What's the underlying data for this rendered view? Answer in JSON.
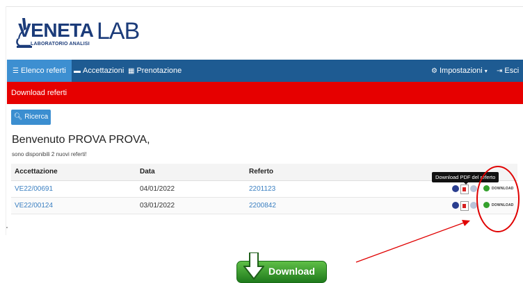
{
  "brand": {
    "name_part1": "VENETA",
    "name_part2": "LAB",
    "tagline": "LABORATORIO ANALISI"
  },
  "nav": {
    "items": [
      {
        "label": "Elenco referti",
        "icon": "list-icon"
      },
      {
        "label": "Accettazioni",
        "icon": "folder-icon"
      },
      {
        "label": "Prenotazione",
        "icon": "calendar-icon"
      }
    ],
    "settings_label": "Impostazioni",
    "logout_label": "Esci"
  },
  "banner": {
    "title": "Download referti"
  },
  "search_button": {
    "label": "Ricerca"
  },
  "welcome": {
    "heading": "Benvenuto PROVA PROVA,",
    "notice": "sono disponibili 2 nuovi referti!"
  },
  "table": {
    "headers": [
      "Accettazione",
      "Data",
      "Referto"
    ],
    "rows": [
      {
        "accettazione": "VE22/00691",
        "data": "04/01/2022",
        "referto": "2201123",
        "download": "DOWNLOAD"
      },
      {
        "accettazione": "VE22/00124",
        "data": "03/01/2022",
        "referto": "2200842",
        "download": "DOWNLOAD"
      }
    ]
  },
  "tooltip": {
    "text": "Download PDF del referto"
  },
  "cta": {
    "label": "Download"
  },
  "colors": {
    "navbar": "#1e5b92",
    "nav_active": "#3d8fd1",
    "banner": "#e60000",
    "link": "#3a7fc1",
    "annotation": "#e00000",
    "download_green": "#33a02c"
  }
}
